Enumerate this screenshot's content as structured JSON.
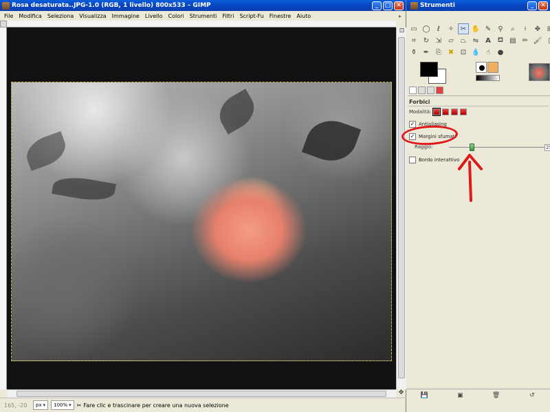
{
  "image_window": {
    "title": "Rosa desaturata..JPG-1.0 (RGB, 1 livello) 800x533 – GIMP",
    "controls": {
      "minimize": "_",
      "maximize": "□",
      "close": "✕"
    },
    "menu": [
      "File",
      "Modifica",
      "Seleziona",
      "Visualizza",
      "Immagine",
      "Livello",
      "Colori",
      "Strumenti",
      "Filtri",
      "Script-Fu",
      "Finestre",
      "Aiuto"
    ],
    "statusbar": {
      "coords": "165, -20",
      "unit": "px",
      "zoom": "100%",
      "message": "Fare clic e trascinare per creare una nuova selezione"
    }
  },
  "toolbox": {
    "title": "Strumenti",
    "controls": {
      "minimize": "_",
      "close": "✕"
    },
    "tool_icons": [
      "rect-select-icon",
      "ellipse-select-icon",
      "lasso-icon",
      "fuzzy-select-icon",
      "scissors-icon",
      "foreground-select-icon",
      "paths-icon",
      "color-picker-icon",
      "zoom-icon",
      "measure-icon",
      "move-icon",
      "align-icon",
      "crop-icon",
      "rotate-icon",
      "scale-icon",
      "shear-icon",
      "perspective-icon",
      "flip-icon",
      "text-icon",
      "bucket-fill-icon",
      "blend-icon",
      "pencil-icon",
      "paintbrush-icon",
      "eraser-icon",
      "airbrush-icon",
      "ink-icon",
      "clone-icon",
      "heal-icon",
      "perspective-clone-icon",
      "blur-icon",
      "smudge-icon",
      "dodge-burn-icon"
    ],
    "tool_options": {
      "title": "Forbici",
      "mode_label": "Modalità:",
      "antialias_label": "Antialiasing",
      "feather_label": "Margini sfumati",
      "feather_checked": true,
      "radius_label": "Raggio:",
      "radius_value": "25",
      "interactive_label": "Bordo interattivo",
      "interactive_checked": false
    }
  },
  "annotation": {
    "color": "#e01818"
  }
}
